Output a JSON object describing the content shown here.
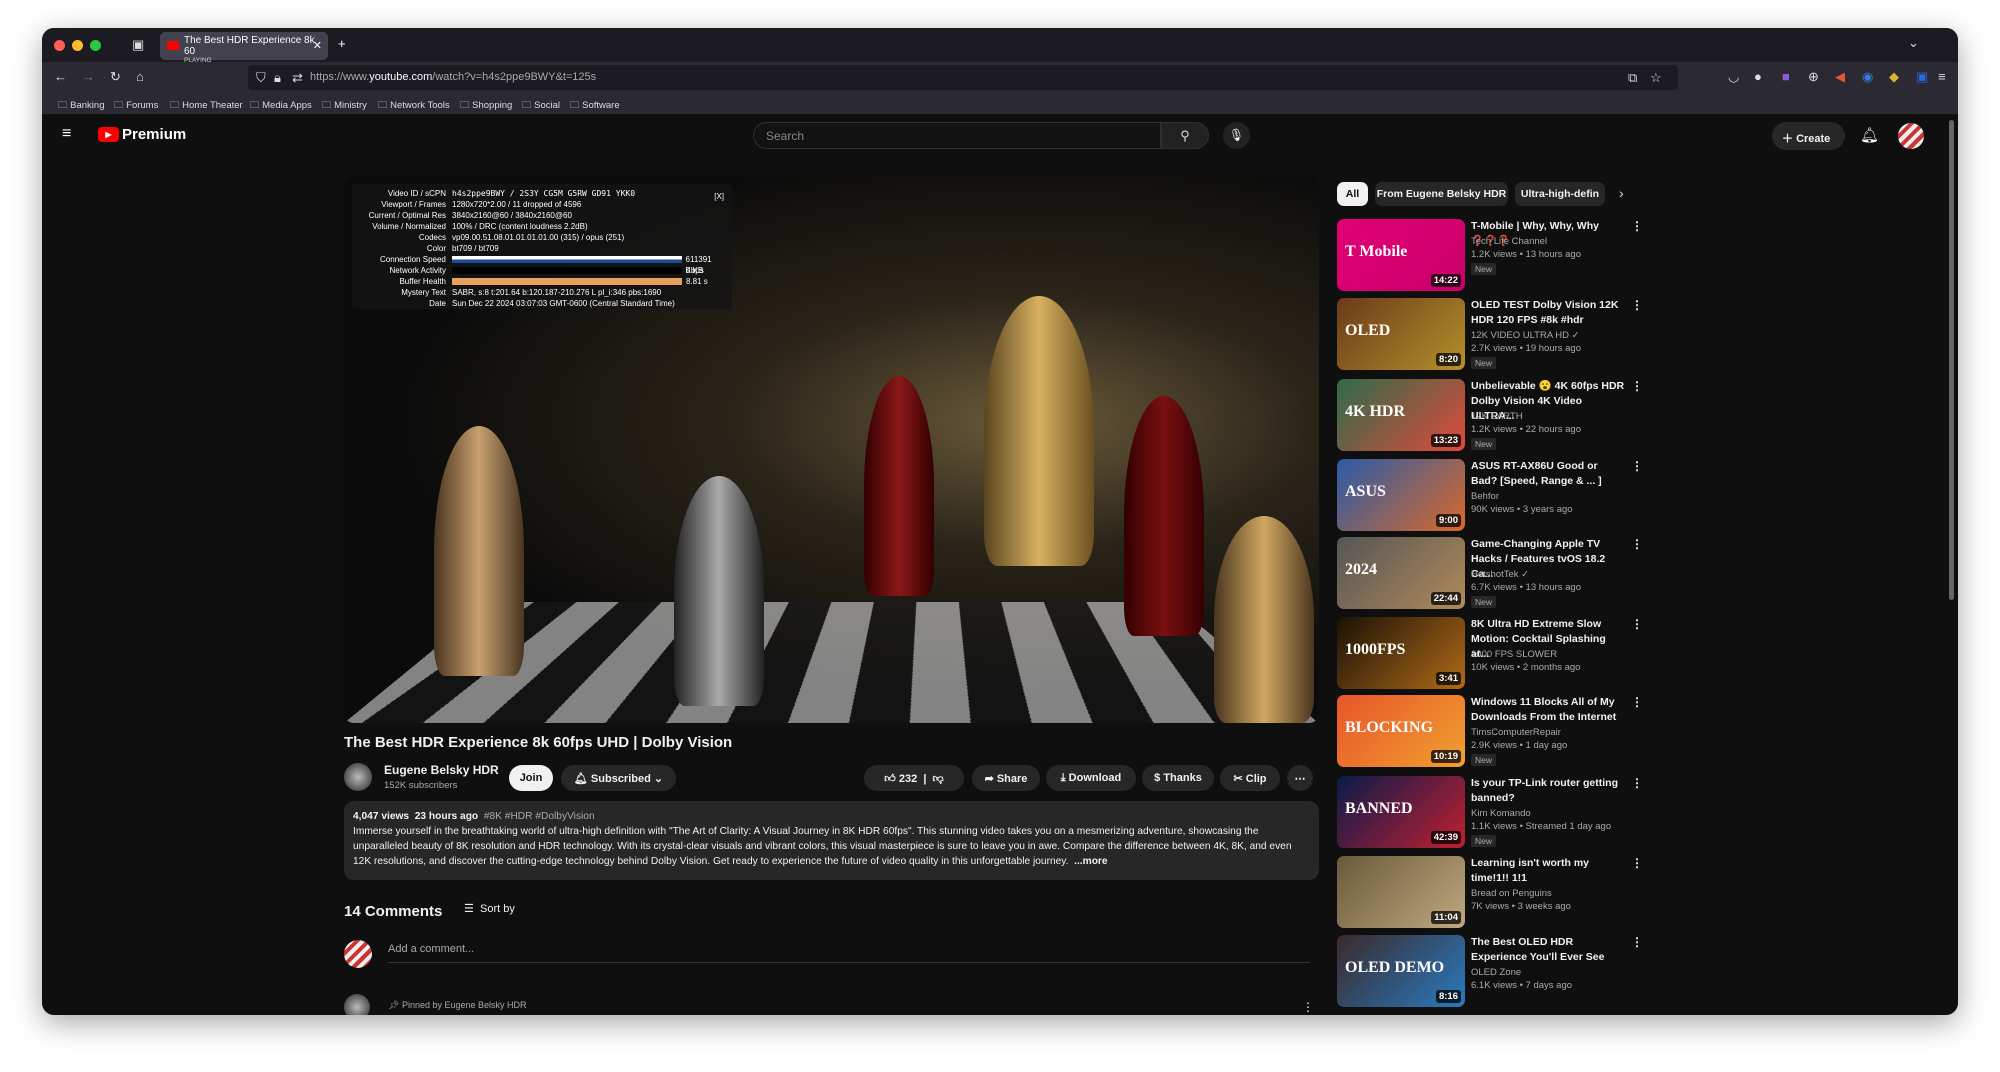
{
  "browser": {
    "tab_title": "The Best HDR Experience 8k 60",
    "tab_status": "PLAYING",
    "url_prefix": "https://www.",
    "url_domain": "youtube.com",
    "url_path": "/watch?v=h4s2ppe9BWY&t=125s",
    "bookmarks": [
      "Banking",
      "Forums",
      "Home Theater",
      "Media Apps",
      "Ministry",
      "Network Tools",
      "Shopping",
      "Social",
      "Software"
    ]
  },
  "header": {
    "logo": "Premium",
    "search_placeholder": "Search",
    "create_label": "Create"
  },
  "stats": {
    "close": "[X]",
    "rows": [
      {
        "k": "Video ID / sCPN",
        "v": "h4s2ppe9BWY / 2S3Y CG5M G5RW GD91 YKK0"
      },
      {
        "k": "Viewport / Frames",
        "v": "1280x720*2.00 / 11 dropped of 4596"
      },
      {
        "k": "Current / Optimal Res",
        "v": "3840x2160@60 / 3840x2160@60"
      },
      {
        "k": "Volume / Normalized",
        "v": "100% / DRC (content loudness 2.2dB)"
      },
      {
        "k": "Codecs",
        "v": "vp09.00.51.08.01.01.01.01.00 (315) / opus (251)"
      },
      {
        "k": "Color",
        "v": "bt709 / bt709"
      },
      {
        "k": "Connection Speed",
        "v": "611391 Kbps"
      },
      {
        "k": "Network Activity",
        "v": "0 KB"
      },
      {
        "k": "Buffer Health",
        "v": "8.81 s"
      },
      {
        "k": "Mystery Text",
        "v": "SABR, s:8 t:201.64 b:120.187-210.276 L pl_i:346 pbs:1690"
      },
      {
        "k": "Date",
        "v": "Sun Dec 22 2024 03:07:03 GMT-0600 (Central Standard Time)"
      }
    ]
  },
  "video": {
    "title": "The Best HDR Experience 8k 60fps UHD | Dolby Vision",
    "channel": "Eugene Belsky HDR",
    "subscribers": "152K subscribers",
    "join": "Join",
    "subscribed": "Subscribed",
    "likes": "232",
    "share": "Share",
    "download": "Download",
    "thanks": "Thanks",
    "clip": "Clip",
    "views": "4,047 views",
    "age": "23 hours ago",
    "tags": "#8K #HDR #DolbyVision",
    "description": "Immerse yourself in the breathtaking world of ultra-high definition with \"The Art of Clarity: A Visual Journey in 8K HDR 60fps\". This stunning video takes you on a mesmerizing adventure, showcasing the unparalleled beauty of 8K resolution and HDR technology. With its crystal-clear visuals and vibrant colors, this visual masterpiece is sure to leave you in awe. Compare the difference between 4K, 8K, and even 12K resolutions, and discover the cutting-edge technology behind Dolby Vision. Get ready to experience the future of video quality in this unforgettable journey.",
    "more": "...more"
  },
  "comments": {
    "count": "14 Comments",
    "sort": "Sort by",
    "placeholder": "Add a comment...",
    "pinned": "Pinned by Eugene Belsky HDR"
  },
  "chips": [
    "All",
    "From Eugene Belsky HDR",
    "Ultra-high-defin"
  ],
  "recs": [
    {
      "title": "T-Mobile | Why, Why, Why ❓❓❓",
      "channel": "Tech Life Channel",
      "meta": "1.2K views • 13 hours ago",
      "new": "New",
      "dur": "14:22",
      "thumb_text": "T Mobile",
      "c1": "#e20074",
      "c2": "#c8006a"
    },
    {
      "title": "OLED TEST Dolby Vision 12K HDR 120 FPS #8k #hdr",
      "channel": "12K VIDEO ULTRA HD ✓",
      "meta": "2.7K views • 19 hours ago",
      "new": "New",
      "dur": "8:20",
      "thumb_text": "OLED",
      "c1": "#6b3a1a",
      "c2": "#b5902a"
    },
    {
      "title": "Unbelievable 😮 4K 60fps HDR Dolby Vision 4K Video ULTRA...",
      "channel": "12K EARTH",
      "meta": "1.2K views • 22 hours ago",
      "new": "New",
      "dur": "13:23",
      "thumb_text": "4K HDR",
      "c1": "#2e6b4a",
      "c2": "#e04a3a"
    },
    {
      "title": "ASUS RT-AX86U Good or Bad? [Speed, Range & ... ]",
      "channel": "Behfor",
      "meta": "90K views • 3 years ago",
      "new": "",
      "dur": "9:00",
      "thumb_text": "ASUS",
      "c1": "#2a5aa8",
      "c2": "#d86a2a"
    },
    {
      "title": "Game-Changing Apple TV Hacks / Features tvOS 18.2 Ca...",
      "channel": "HotshotTek ✓",
      "meta": "6.7K views • 13 hours ago",
      "new": "New",
      "dur": "22:44",
      "thumb_text": "2024",
      "c1": "#555",
      "c2": "#b08a5a"
    },
    {
      "title": "8K Ultra HD Extreme Slow Motion: Cocktail Splashing at...",
      "channel": "1000 FPS SLOWER",
      "meta": "10K views • 2 months ago",
      "new": "",
      "dur": "3:41",
      "thumb_text": "1000FPS",
      "c1": "#1a1206",
      "c2": "#b06a18"
    },
    {
      "title": "Windows 11 Blocks All of My Downloads From the Internet",
      "channel": "TimsComputerRepair",
      "meta": "2.9K views • 1 day ago",
      "new": "New",
      "dur": "10:19",
      "thumb_text": "BLOCKING",
      "c1": "#e8552a",
      "c2": "#f0a030"
    },
    {
      "title": "Is your TP-Link router getting banned?",
      "channel": "Kim Komando",
      "meta": "1.1K views • Streamed 1 day ago",
      "new": "New",
      "dur": "42:39",
      "thumb_text": "BANNED",
      "c1": "#0a1a4a",
      "c2": "#c02030"
    },
    {
      "title": "Learning isn't worth my time!1!! 1!1",
      "channel": "Bread on Penguins",
      "meta": "7K views • 3 weeks ago",
      "new": "",
      "dur": "11:04",
      "thumb_text": "",
      "c1": "#6a5a3a",
      "c2": "#c0a880"
    },
    {
      "title": "The Best OLED HDR Experience You'll Ever See",
      "channel": "OLED Zone",
      "meta": "6.1K views • 7 days ago",
      "new": "",
      "dur": "8:16",
      "thumb_text": "OLED DEMO",
      "c1": "#3a2a2a",
      "c2": "#2a7ac0"
    }
  ]
}
